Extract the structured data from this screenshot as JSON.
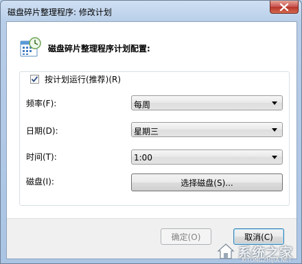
{
  "window": {
    "title": "磁盘碎片整理程序: 修改计划",
    "close_icon": "close-icon"
  },
  "header": {
    "icon": "calendar-clock-icon",
    "text": "磁盘碎片整理程序计划配置:"
  },
  "schedule": {
    "run_on_schedule_label": "按计划运行(推荐)(R)",
    "run_on_schedule_checked": true,
    "frequency": {
      "label": "频率(F):",
      "value": "每周"
    },
    "day": {
      "label": "日期(D):",
      "value": "星期三"
    },
    "time": {
      "label": "时间(T):",
      "value": "1:00"
    },
    "disks": {
      "label": "磁盘(I):",
      "button": "选择磁盘(S)..."
    }
  },
  "footer": {
    "ok_button": "确定(O)",
    "cancel_button": "取消(C)"
  },
  "watermark": {
    "text": "系统之家",
    "subtext": "XITONGZHIJIA.NET"
  },
  "colors": {
    "frame": "#b9d1ea",
    "close_button": "#c75050",
    "footer": "#f0f0f0"
  }
}
